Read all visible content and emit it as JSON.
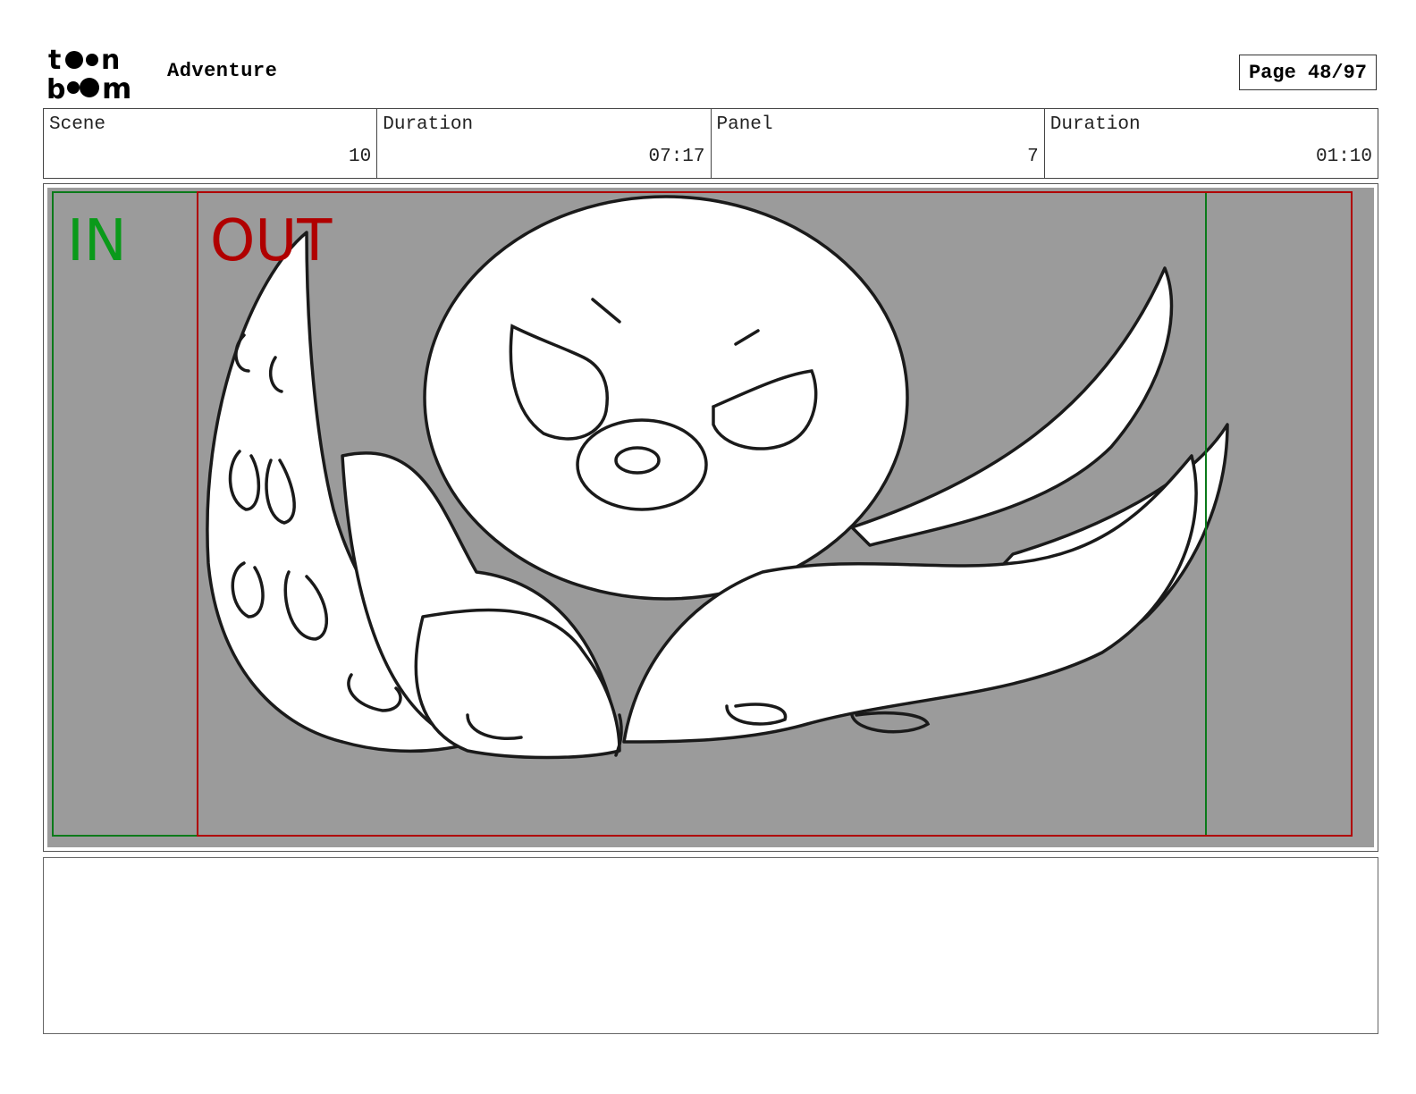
{
  "header": {
    "logo_alt": "toon boom",
    "project_title": "Adventure",
    "page_label": "Page 48/97"
  },
  "info": {
    "scene_label": "Scene",
    "scene_value": "10",
    "scene_duration_label": "Duration",
    "scene_duration_value": "07:17",
    "panel_label": "Panel",
    "panel_value": "7",
    "panel_duration_label": "Duration",
    "panel_duration_value": "01:10"
  },
  "panel": {
    "in_marker": "IN",
    "out_marker": "OUT",
    "in_color": "#0a9a1a",
    "out_color": "#b00000",
    "background_color": "#9b9b9b",
    "drawing": "octopus-sketch"
  },
  "notes": {
    "text": ""
  }
}
